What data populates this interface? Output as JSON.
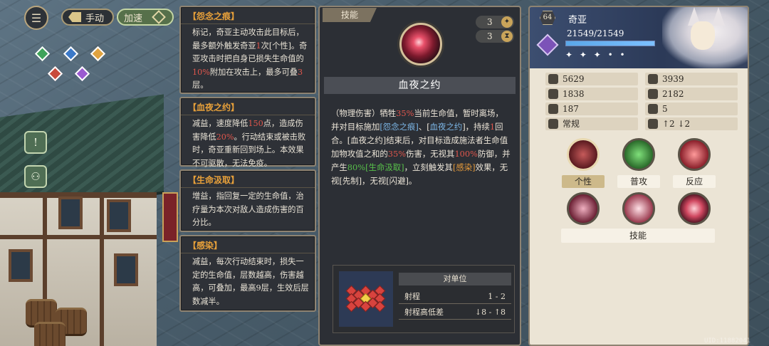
{
  "controls": {
    "manual_label": "手动",
    "speed_label": "加速"
  },
  "tooltips": [
    {
      "title": "【怨念之痕】",
      "segments": [
        {
          "t": "标记，奇亚主动攻击此目标后，最多额外触发奇亚"
        },
        {
          "t": "1",
          "c": "red"
        },
        {
          "t": "次[个性]。奇亚攻击时把自身已损失生命值的"
        },
        {
          "t": "10%",
          "c": "red"
        },
        {
          "t": "附加在攻击上，最多可叠"
        },
        {
          "t": "3",
          "c": "red"
        },
        {
          "t": "层。"
        }
      ]
    },
    {
      "title": "【血夜之约】",
      "segments": [
        {
          "t": "减益，速度降低"
        },
        {
          "t": "150",
          "c": "red"
        },
        {
          "t": "点，造成伤害降低"
        },
        {
          "t": "20%",
          "c": "red"
        },
        {
          "t": "。行动结束或被击败时，奇亚重新回到场上。本效果不可驱散，无法免疫。"
        }
      ]
    },
    {
      "title": "【生命汲取】",
      "segments": [
        {
          "t": "增益，指回复一定的生命值，治疗量为本次对敌人造成伤害的百分比。"
        }
      ]
    },
    {
      "title": "【感染】",
      "segments": [
        {
          "t": "减益，每次行动结束时，损失一定的生命值，层数越高，伤害越高，可叠加，最高9层，生效后层数减半。"
        }
      ]
    }
  ],
  "skill": {
    "tab_label": "技能",
    "cost1": "3",
    "cost2": "3",
    "name": "血夜之约",
    "description": [
      {
        "t": "（物理伤害）牺牲"
      },
      {
        "t": "35%",
        "c": "red"
      },
      {
        "t": "当前生命值，暂时离场，并对目标施加"
      },
      {
        "t": "[怨念之痕]",
        "c": "blue"
      },
      {
        "t": "、["
      },
      {
        "t": "血夜之约",
        "c": "blue"
      },
      {
        "t": "]，持续"
      },
      {
        "t": "1",
        "c": "red"
      },
      {
        "t": "回合。[血夜之约]结束后，对目标造成施法者生命值加物攻值之和的"
      },
      {
        "t": "35%",
        "c": "red"
      },
      {
        "t": "伤害，无视其"
      },
      {
        "t": "100%",
        "c": "red"
      },
      {
        "t": "防御，并产生"
      },
      {
        "t": "80%",
        "c": "green"
      },
      {
        "t": "[生命汲取]",
        "c": "green"
      },
      {
        "t": "，立刻触发其"
      },
      {
        "t": "[感染]",
        "c": "orange"
      },
      {
        "t": "效果，无视[先制]，无视[闪避]。"
      }
    ],
    "range": {
      "header": "对单位",
      "rows": [
        {
          "label": "射程",
          "value": "1 - 2"
        },
        {
          "label": "射程高低差",
          "value": "↓8 - ↑8"
        }
      ]
    }
  },
  "character": {
    "level": "64",
    "name": "奇亚",
    "hp_text": "21549/21549",
    "hp_fraction": 1.0,
    "stars": "✦ ✦ ✦ • •",
    "stats": [
      {
        "icon": "sword-icon",
        "value": "5629"
      },
      {
        "icon": "magic-icon",
        "value": "3939"
      },
      {
        "icon": "shield-icon",
        "value": "1838"
      },
      {
        "icon": "magic-defense-icon",
        "value": "2182"
      },
      {
        "icon": "speed-icon",
        "value": "187"
      },
      {
        "icon": "movement-icon",
        "value": "5"
      },
      {
        "icon": "class-icon",
        "value": "常规"
      },
      {
        "icon": "height-icon",
        "value": "↑2 ↓2"
      }
    ],
    "skill_labels": {
      "personality": "个性",
      "attack": "普攻",
      "reaction": "反应",
      "skills": "技能"
    }
  },
  "watermark": "UID:11882041",
  "colors": {
    "accent_gold": "#c9a45a",
    "highlight_red": "#e0564c",
    "highlight_orange": "#e8a13a",
    "highlight_blue": "#7cb6e6",
    "highlight_green": "#58c04a"
  }
}
